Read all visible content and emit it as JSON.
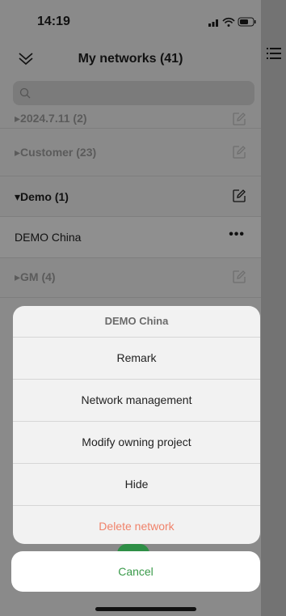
{
  "status": {
    "time": "14:19"
  },
  "header": {
    "title": "My networks (41)"
  },
  "search": {
    "placeholder": ""
  },
  "list": {
    "groups": [
      {
        "label": "▸2024.7.11 (2)"
      },
      {
        "label": "▸Customer (23)"
      },
      {
        "label": "▾Demo (1)"
      },
      {
        "label": "▸GM (4)"
      }
    ],
    "child": {
      "label": "DEMO China",
      "more": "•••"
    }
  },
  "sheet": {
    "title": "DEMO China",
    "options": [
      "Remark",
      "Network management",
      "Modify owning project",
      "Hide"
    ],
    "danger": "Delete network",
    "cancel": "Cancel"
  },
  "colors": {
    "accent": "#3a9a4a",
    "danger": "#f0826a"
  }
}
